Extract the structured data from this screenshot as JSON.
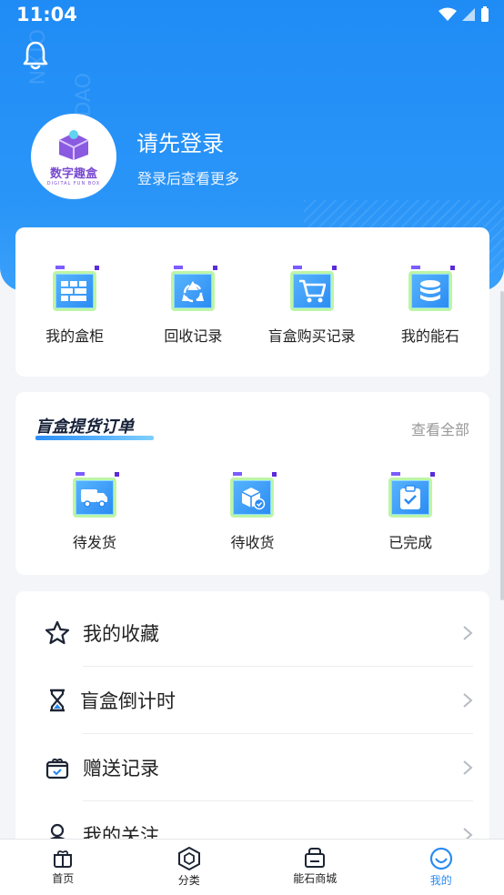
{
  "status_bar": {
    "time": "11:04"
  },
  "header": {
    "login_title": "请先登录",
    "login_subtitle": "登录后查看更多",
    "avatar_brand": "数字趣盒",
    "avatar_brand_sub": "DIGITAL FUN BOX"
  },
  "quick_menu": [
    {
      "label": "我的盒柜",
      "icon": "cabinet-icon"
    },
    {
      "label": "回收记录",
      "icon": "recycle-icon"
    },
    {
      "label": "盲盒购买记录",
      "icon": "cart-icon"
    },
    {
      "label": "我的能石",
      "icon": "coins-icon"
    }
  ],
  "orders": {
    "title": "盲盒提货订单",
    "view_all": "查看全部",
    "items": [
      {
        "label": "待发货",
        "icon": "truck-icon"
      },
      {
        "label": "待收货",
        "icon": "package-icon"
      },
      {
        "label": "已完成",
        "icon": "clipboard-check-icon"
      }
    ]
  },
  "menu_list": [
    {
      "label": "我的收藏",
      "icon": "star-icon"
    },
    {
      "label": "盲盒倒计时",
      "icon": "hourglass-icon"
    },
    {
      "label": "赠送记录",
      "icon": "gift-record-icon"
    },
    {
      "label": "我的关注",
      "icon": "user-icon"
    }
  ],
  "tab_bar": [
    {
      "label": "首页",
      "icon": "home-gift-icon",
      "active": false
    },
    {
      "label": "分类",
      "icon": "category-cube-icon",
      "active": false
    },
    {
      "label": "能石商城",
      "icon": "shop-bag-icon",
      "active": false
    },
    {
      "label": "我的",
      "icon": "profile-smile-icon",
      "active": true
    }
  ],
  "colors": {
    "primary": "#2a8bf2",
    "hero": "#1f8cf6",
    "background": "#f3f5f8"
  }
}
